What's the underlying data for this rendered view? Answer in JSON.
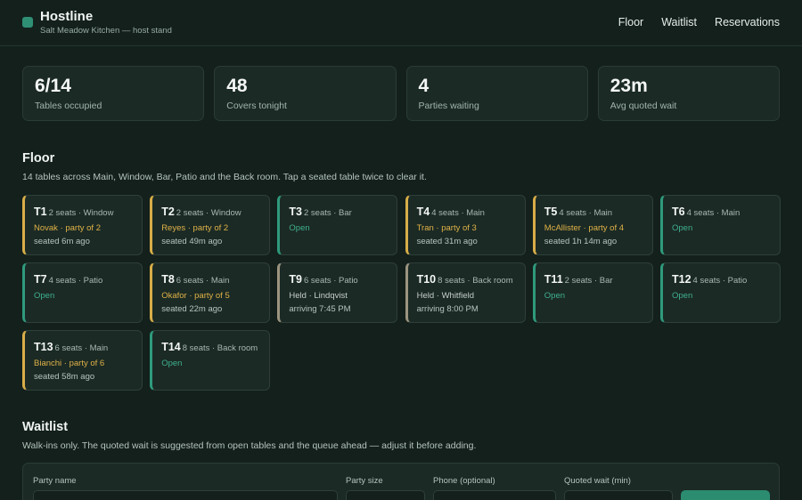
{
  "header": {
    "title": "Hostline",
    "subtitle": "Salt Meadow Kitchen — host stand",
    "nav": [
      "Floor",
      "Waitlist",
      "Reservations"
    ],
    "logo_color": "#2f8f75"
  },
  "stats": [
    {
      "value": "6/14",
      "label": "Tables occupied"
    },
    {
      "value": "48",
      "label": "Covers tonight"
    },
    {
      "value": "4",
      "label": "Parties waiting"
    },
    {
      "value": "23m",
      "label": "Avg quoted wait"
    }
  ],
  "floor": {
    "title": "Floor",
    "description": "14 tables across Main, Window, Bar, Patio and the Back room. Tap a seated table twice to clear it.",
    "tables": [
      {
        "name": "T1",
        "meta": "2 seats · Window",
        "status": "seated",
        "line1": "Novak · party of 2",
        "line2": "seated 6m ago"
      },
      {
        "name": "T2",
        "meta": "2 seats · Window",
        "status": "seated",
        "line1": "Reyes · party of 2",
        "line2": "seated 49m ago"
      },
      {
        "name": "T3",
        "meta": "2 seats · Bar",
        "status": "open",
        "line1": "Open",
        "line2": ""
      },
      {
        "name": "T4",
        "meta": "4 seats · Main",
        "status": "seated",
        "line1": "Tran · party of 3",
        "line2": "seated 31m ago"
      },
      {
        "name": "T5",
        "meta": "4 seats · Main",
        "status": "seated",
        "line1": "McAllister · party of 4",
        "line2": "seated 1h 14m ago"
      },
      {
        "name": "T6",
        "meta": "4 seats · Main",
        "status": "open",
        "line1": "Open",
        "line2": ""
      },
      {
        "name": "T7",
        "meta": "4 seats · Patio",
        "status": "open",
        "line1": "Open",
        "line2": ""
      },
      {
        "name": "T8",
        "meta": "6 seats · Main",
        "status": "seated",
        "line1": "Okafor · party of 5",
        "line2": "seated 22m ago"
      },
      {
        "name": "T9",
        "meta": "6 seats · Patio",
        "status": "held",
        "line1": "Held · Lindqvist",
        "line2": "arriving 7:45 PM"
      },
      {
        "name": "T10",
        "meta": "8 seats · Back room",
        "status": "held",
        "line1": "Held · Whitfield",
        "line2": "arriving 8:00 PM"
      },
      {
        "name": "T11",
        "meta": "2 seats · Bar",
        "status": "open",
        "line1": "Open",
        "line2": ""
      },
      {
        "name": "T12",
        "meta": "4 seats · Patio",
        "status": "open",
        "line1": "Open",
        "line2": ""
      },
      {
        "name": "T13",
        "meta": "6 seats · Main",
        "status": "seated",
        "line1": "Bianchi · party of 6",
        "line2": "seated 58m ago"
      },
      {
        "name": "T14",
        "meta": "8 seats · Back room",
        "status": "open",
        "line1": "Open",
        "line2": ""
      }
    ],
    "status_colors": {
      "open": "#2f9a7c",
      "seated": "#d8ad48",
      "held": "#9c947f"
    }
  },
  "waitlist": {
    "title": "Waitlist",
    "description": "Walk-ins only. The quoted wait is suggested from open tables and the queue ahead — adjust it before adding.",
    "fields": {
      "party_name_label": "Party name",
      "party_size_label": "Party size",
      "phone_label": "Phone (optional)",
      "quoted_wait_label": "Quoted wait (min)"
    }
  }
}
